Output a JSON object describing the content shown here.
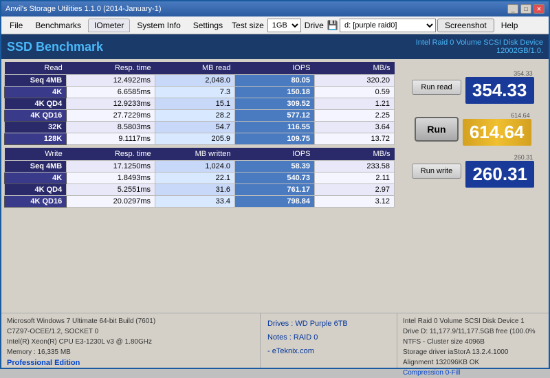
{
  "window": {
    "title": "Anvil's Storage Utilities 1.1.0 (2014-January-1)",
    "controls": {
      "minimize": "_",
      "maximize": "□",
      "close": "✕"
    }
  },
  "menubar": {
    "items": [
      "File",
      "Benchmarks",
      "IOmeter",
      "System Info",
      "Settings"
    ],
    "testsize_label": "Test size",
    "testsize_value": "1GB",
    "drive_label": "Drive",
    "drive_icon": "💾",
    "drive_value": "d: [purple raid0]",
    "screenshot_label": "Screenshot",
    "help_label": "Help"
  },
  "benchmark": {
    "title": "SSD Benchmark",
    "drive_name": "Intel Raid 0 Volume SCSI Disk Device",
    "drive_size": "12002GB/1.0."
  },
  "read_table": {
    "headers": [
      "Read",
      "Resp. time",
      "MB read",
      "IOPS",
      "MB/s"
    ],
    "rows": [
      {
        "label": "Seq 4MB",
        "resp": "12.4922ms",
        "mb": "2,048.0",
        "iops": "80.05",
        "mbs": "320.20"
      },
      {
        "label": "4K",
        "resp": "6.6585ms",
        "mb": "7.3",
        "iops": "150.18",
        "mbs": "0.59"
      },
      {
        "label": "4K QD4",
        "resp": "12.9233ms",
        "mb": "15.1",
        "iops": "309.52",
        "mbs": "1.21"
      },
      {
        "label": "4K QD16",
        "resp": "27.7229ms",
        "mb": "28.2",
        "iops": "577.12",
        "mbs": "2.25"
      },
      {
        "label": "32K",
        "resp": "8.5803ms",
        "mb": "54.7",
        "iops": "116.55",
        "mbs": "3.64"
      },
      {
        "label": "128K",
        "resp": "9.1117ms",
        "mb": "205.9",
        "iops": "109.75",
        "mbs": "13.72"
      }
    ]
  },
  "write_table": {
    "headers": [
      "Write",
      "Resp. time",
      "MB written",
      "IOPS",
      "MB/s"
    ],
    "rows": [
      {
        "label": "Seq 4MB",
        "resp": "17.1250ms",
        "mb": "1,024.0",
        "iops": "58.39",
        "mbs": "233.58"
      },
      {
        "label": "4K",
        "resp": "1.8493ms",
        "mb": "22.1",
        "iops": "540.73",
        "mbs": "2.11"
      },
      {
        "label": "4K QD4",
        "resp": "5.2551ms",
        "mb": "31.6",
        "iops": "761.17",
        "mbs": "2.97"
      },
      {
        "label": "4K QD16",
        "resp": "20.0297ms",
        "mb": "33.4",
        "iops": "798.84",
        "mbs": "3.12"
      }
    ]
  },
  "scores": {
    "read_label": "Run read",
    "read_score_small": "354.33",
    "read_score": "354.33",
    "run_label": "Run",
    "total_score_small": "614.64",
    "total_score": "614.64",
    "write_label": "Run write",
    "write_score_small": "260.31",
    "write_score": "260.31"
  },
  "statusbar": {
    "left": {
      "os": "Microsoft Windows 7 Ultimate  64-bit Build (7601)",
      "cpu1": "C7Z97-OCEE/1.2, SOCKET 0",
      "cpu2": "Intel(R) Xeon(R) CPU E3-1230L v3 @ 1.80GHz",
      "memory": "Memory : 16,335 MB",
      "edition": "Professional Edition"
    },
    "center": {
      "drives": "Drives : WD Purple 6TB",
      "notes": "Notes : RAID 0",
      "credit": "- eTeknix.com"
    },
    "right": {
      "device": "Intel Raid 0 Volume SCSI Disk Device 1",
      "drive_info": "Drive D: 11,177.9/11,177.5GB free (100.0%",
      "ntfs": "NTFS - Cluster size 4096B",
      "storage_driver": "Storage driver  iaStorA 13.2.4.1000",
      "alignment": "Alignment 132096KB OK",
      "compression": "Compression 0-Fill"
    }
  }
}
